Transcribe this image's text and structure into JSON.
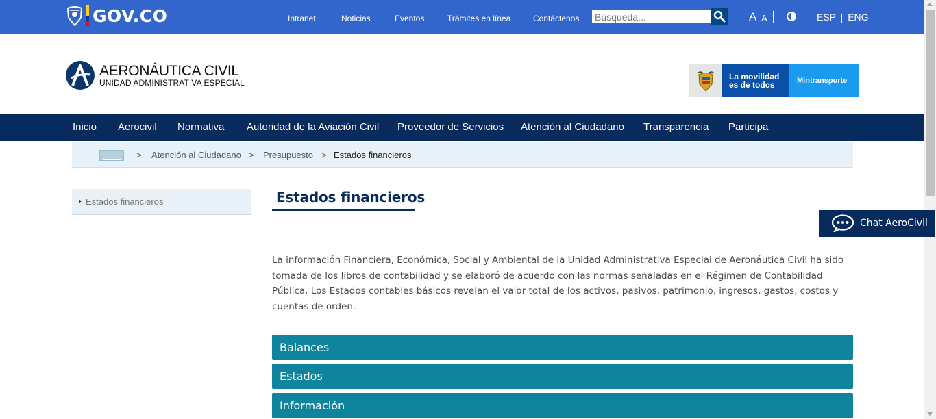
{
  "gov": {
    "logo_text": "GOV.CO",
    "nav": [
      "Intranet",
      "Noticias",
      "Eventos",
      "Trámites en línea",
      "Contáctenos"
    ],
    "search_placeholder": "Búsqueda...",
    "font_large": "A",
    "font_small": "A",
    "lang_esp": "ESP",
    "lang_sep": "|",
    "lang_eng": "ENG"
  },
  "header": {
    "brand_title": "AERONÁUTICA CIVIL",
    "brand_subtitle": "UNIDAD ADMINISTRATIVA ESPECIAL",
    "banner_text_1": "La movilidad",
    "banner_text_2": "es de todos",
    "banner_ministry": "Mintransporte"
  },
  "main_nav": [
    "Inicio",
    "Aerocivil",
    "Normativa",
    "Autoridad de la Aviación Civil",
    "Proveedor de Servicios",
    "Atención al Ciudadano",
    "Transparencia",
    "Participa"
  ],
  "breadcrumb": {
    "separator": ">",
    "items": [
      "Atención al Ciudadano",
      "Presupuesto",
      "Estados financieros"
    ]
  },
  "sidebar": {
    "items": [
      {
        "label": "Estados financieros"
      }
    ]
  },
  "content": {
    "title": "Estados financieros",
    "intro": "La información Financiera, Económica, Social y Ambiental de la Unidad Administrativa Especial de Aeronáutica Civil ha sido tomada de los libros de contabilidad y se elaboró de acuerdo con las normas señaladas en el Régimen de Contabilidad Pública.  Los Estados contables básicos revelan el valor total de los activos, pasivos, patrimonio, ingresos, gastos, costos y cuentas de orden.",
    "accordions": [
      "Balances",
      "Estados",
      "Información"
    ]
  },
  "chat": {
    "label": "Chat AeroCivil"
  },
  "colors": {
    "gov_bar": "#3366cc",
    "nav_bg": "#072b5c",
    "accordion": "#0f849c",
    "breadcrumb_bg": "#e9f1f8"
  }
}
